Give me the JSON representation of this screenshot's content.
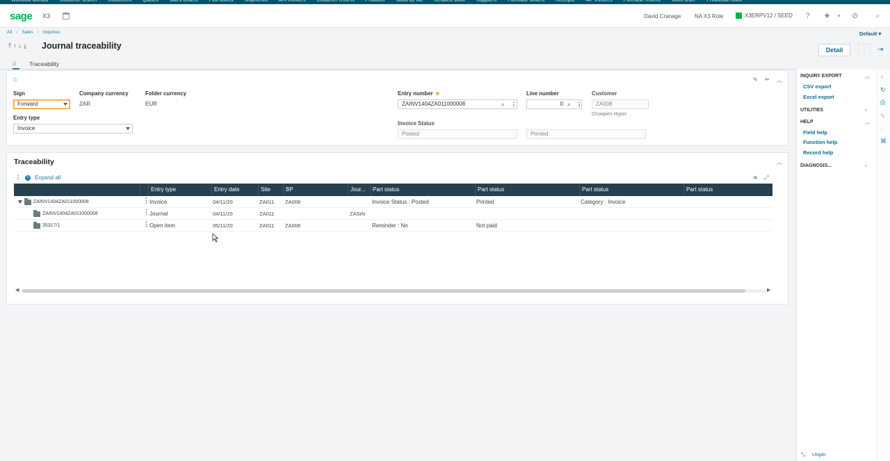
{
  "topnav": [
    "Workflow Monitor",
    "Customer search",
    "Customers",
    "Quotes",
    "Sales Orders",
    "Pick tickets",
    "Shipments",
    "A/R invoices",
    "Customer returns",
    "Products",
    "Stock by site",
    "Detailed stock",
    "Suppliers",
    "Purchase Orders",
    "Receipts",
    "A/P invoices",
    "Purchase returns",
    "Work order",
    "Production track"
  ],
  "header": {
    "logo": "sage",
    "product": "X3",
    "user": "David Cranage",
    "role": "NA X3 Role",
    "folder": "X3ERPV12 / SEED",
    "icons": [
      "help-icon",
      "star-icon",
      "compass-icon",
      "search-icon"
    ]
  },
  "breadcrumb": [
    "All",
    "Sales",
    "Inquiries"
  ],
  "default_label": "Default",
  "title": "Journal traceability",
  "detail_button": "Detail",
  "tabs": {
    "traceability": "Traceability"
  },
  "form": {
    "sign_label": "Sign",
    "sign_value": "Forward",
    "company_currency_label": "Company currency",
    "company_currency_value": "ZAR",
    "folder_currency_label": "Folder currency",
    "folder_currency_value": "EUR",
    "entry_type_label": "Entry type",
    "entry_type_value": "Invoice",
    "entry_number_label": "Entry number",
    "entry_number_value": "ZAINV1404ZA011000008",
    "line_number_label": "Line number",
    "line_number_value": "0",
    "customer_label": "Customer",
    "customer_value": "ZA008",
    "customer_name": "Choopies Hyper",
    "invoice_status_label": "Invoice Status",
    "invoice_status_value": "Posted",
    "invoice_status_value2": "Printed"
  },
  "traceability": {
    "title": "Traceability",
    "expand_all": "Expand all",
    "columns": [
      "Entry type",
      "Entry date",
      "Site",
      "BP",
      "Jour...",
      "Part status",
      "Part status",
      "Part status",
      "Part status"
    ],
    "rows": [
      {
        "name": "ZAINV1404ZA011000008",
        "entry_type": "Invoice",
        "entry_date": "04/11/20",
        "site": "ZA011",
        "bp": "ZA008",
        "journal": "",
        "s1": "Invoice Status : Posted",
        "s2": "Printed",
        "s3": "Category : Invoice",
        "s4": ""
      },
      {
        "name": "ZAINV1404ZA011000008",
        "entry_type": "Journal",
        "entry_date": "04/11/20",
        "site": "ZA011",
        "bp": "",
        "journal": "ZASIN",
        "s1": "",
        "s2": "",
        "s3": "",
        "s4": ""
      },
      {
        "name": "35317/1",
        "entry_type": "Open item",
        "entry_date": "05/11/20",
        "site": "ZA011",
        "bp": "ZA008",
        "journal": "",
        "s1": "Reminder : No",
        "s2": "Not paid",
        "s3": "",
        "s4": ""
      }
    ]
  },
  "sidebar": {
    "inquiry_export": "INQUIRY EXPORT",
    "csv_export": "CSV export",
    "excel_export": "Excel export",
    "utilities": "UTILITIES",
    "help": "HELP",
    "field_help": "Field help",
    "function_help": "Function help",
    "record_help": "Record help",
    "diagnosis": "DIAGNOSIS...",
    "unpin": "Unpin"
  },
  "colors": {
    "brand": "#00b050",
    "nav": "#00546b",
    "grid_header": "#26404d",
    "link": "#0a6a8f"
  }
}
